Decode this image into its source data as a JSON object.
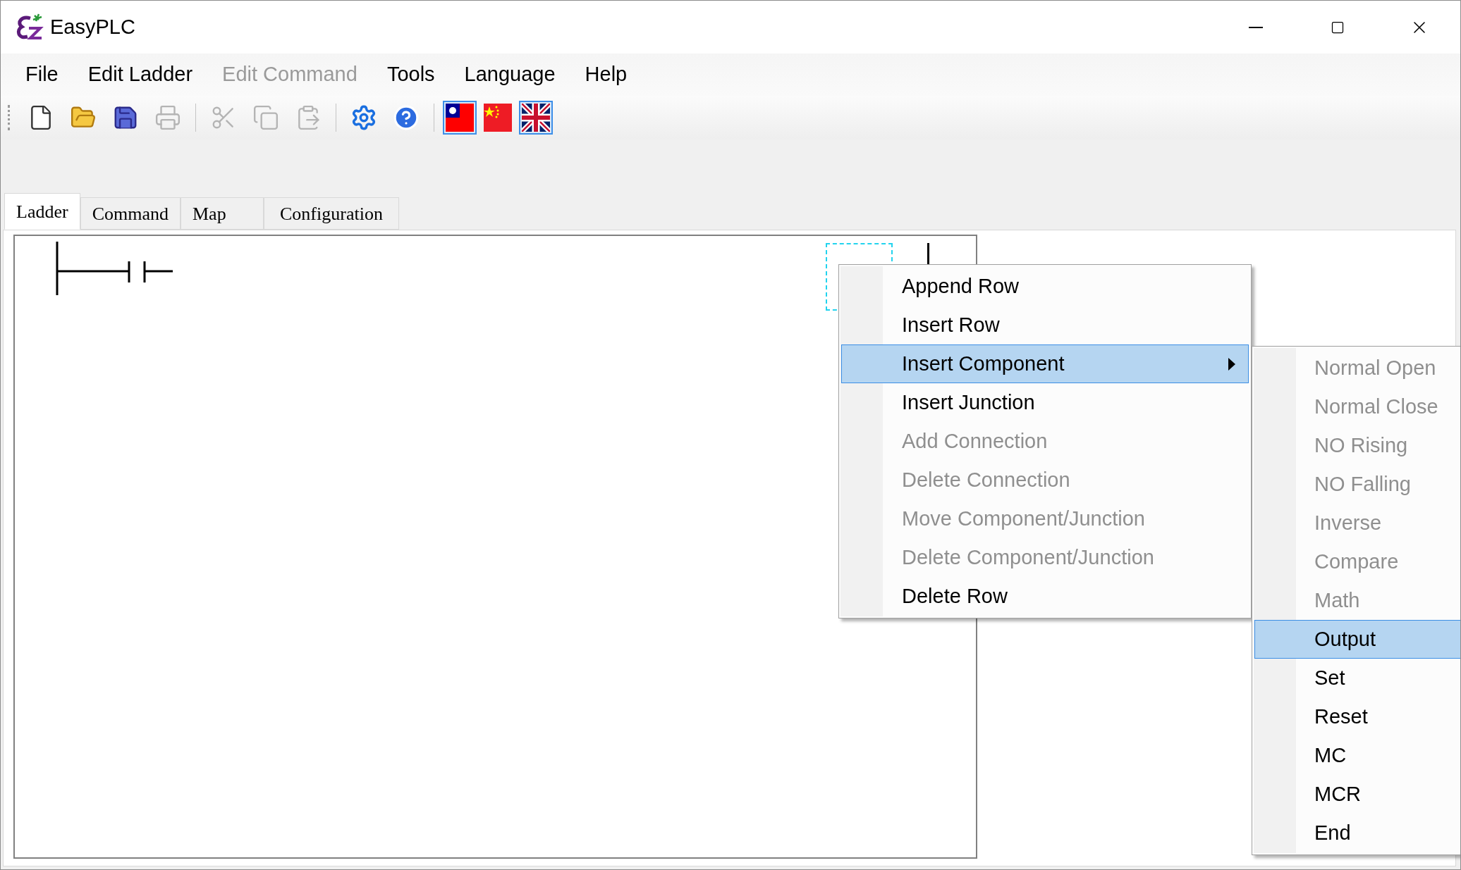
{
  "window": {
    "title": "EasyPLC"
  },
  "menu_bar": [
    {
      "label": "File",
      "disabled": false
    },
    {
      "label": "Edit Ladder",
      "disabled": false
    },
    {
      "label": "Edit Command",
      "disabled": true
    },
    {
      "label": "Tools",
      "disabled": false
    },
    {
      "label": "Language",
      "disabled": false
    },
    {
      "label": "Help",
      "disabled": false
    }
  ],
  "toolbar": [
    {
      "kind": "new",
      "disabled": false
    },
    {
      "kind": "open",
      "disabled": false
    },
    {
      "kind": "save",
      "disabled": false
    },
    {
      "kind": "print",
      "disabled": true
    },
    {
      "kind": "separator"
    },
    {
      "kind": "cut",
      "disabled": true
    },
    {
      "kind": "copy",
      "disabled": true
    },
    {
      "kind": "paste",
      "disabled": true
    },
    {
      "kind": "separator"
    },
    {
      "kind": "settings",
      "disabled": false
    },
    {
      "kind": "help",
      "disabled": false
    },
    {
      "kind": "separator"
    },
    {
      "kind": "flag_tw",
      "selected": true
    },
    {
      "kind": "flag_cn",
      "selected": false
    },
    {
      "kind": "flag_uk",
      "selected": true
    }
  ],
  "tabs": [
    {
      "label": "Ladder",
      "selected": true
    },
    {
      "label": "Command",
      "selected": false
    },
    {
      "label": "Map",
      "selected": false
    },
    {
      "label": "Configuration",
      "selected": false
    }
  ],
  "context_menu": {
    "items": [
      {
        "label": "Append Row",
        "disabled": false,
        "selected": false,
        "has_submenu": false
      },
      {
        "label": "Insert Row",
        "disabled": false,
        "selected": false,
        "has_submenu": false
      },
      {
        "label": "Insert Component",
        "disabled": false,
        "selected": true,
        "has_submenu": true
      },
      {
        "label": "Insert Junction",
        "disabled": false,
        "selected": false,
        "has_submenu": false
      },
      {
        "label": "Add Connection",
        "disabled": true,
        "selected": false,
        "has_submenu": false
      },
      {
        "label": "Delete Connection",
        "disabled": true,
        "selected": false,
        "has_submenu": false
      },
      {
        "label": "Move Component/Junction",
        "disabled": true,
        "selected": false,
        "has_submenu": false
      },
      {
        "label": "Delete Component/Junction",
        "disabled": true,
        "selected": false,
        "has_submenu": false
      },
      {
        "label": "Delete Row",
        "disabled": false,
        "selected": false,
        "has_submenu": false
      }
    ]
  },
  "submenu": {
    "items": [
      {
        "label": "Normal Open",
        "disabled": true,
        "selected": false
      },
      {
        "label": "Normal Close",
        "disabled": true,
        "selected": false
      },
      {
        "label": "NO Rising",
        "disabled": true,
        "selected": false
      },
      {
        "label": "NO Falling",
        "disabled": true,
        "selected": false
      },
      {
        "label": "Inverse",
        "disabled": true,
        "selected": false
      },
      {
        "label": "Compare",
        "disabled": true,
        "selected": false
      },
      {
        "label": "Math",
        "disabled": true,
        "selected": false
      },
      {
        "label": "Output",
        "disabled": false,
        "selected": true
      },
      {
        "label": "Set",
        "disabled": false,
        "selected": false
      },
      {
        "label": "Reset",
        "disabled": false,
        "selected": false
      },
      {
        "label": "MC",
        "disabled": false,
        "selected": false
      },
      {
        "label": "MCR",
        "disabled": false,
        "selected": false
      },
      {
        "label": "End",
        "disabled": false,
        "selected": false
      }
    ]
  }
}
